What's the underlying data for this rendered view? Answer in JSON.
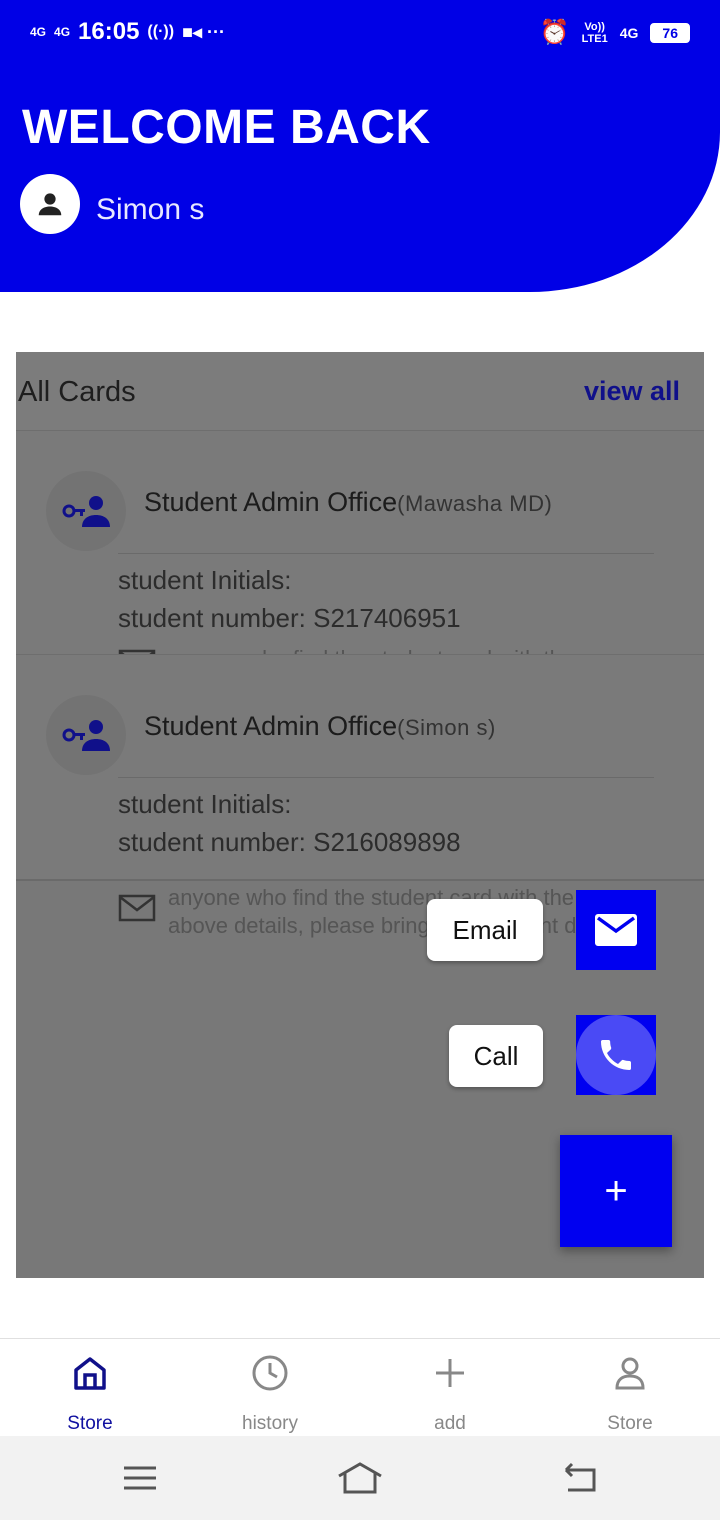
{
  "status_bar": {
    "signal1": "4G",
    "signal2": "4G",
    "time": "16:05",
    "volte": "Vo))",
    "lte": "LTE1",
    "net": "4G",
    "battery": "76"
  },
  "header": {
    "title": "WELCOME BACK",
    "username": "Simon s"
  },
  "cards_section": {
    "title": "All Cards",
    "view_all": "view all"
  },
  "cards": [
    {
      "title": "Student Admin Office",
      "owner": "(Mawasha MD)",
      "initials": "student Initials:",
      "number": "student number: S217406951",
      "message": "anyone who find the student card with the"
    },
    {
      "title": "Student Admin Office",
      "owner": "(Simon s)",
      "initials": "student Initials:",
      "number": "student number: S216089898",
      "message": "anyone who find the student card with the"
    }
  ],
  "overflow_message": "above details, please bring it to the front desk",
  "fab": {
    "email_label": "Email",
    "call_label": "Call",
    "main_symbol": "+"
  },
  "bottom_nav": {
    "items": [
      {
        "label": "Store",
        "icon": "home-icon",
        "active": true
      },
      {
        "label": "history",
        "icon": "clock-icon",
        "active": false
      },
      {
        "label": "add",
        "icon": "plus-icon",
        "active": false
      },
      {
        "label": "Store",
        "icon": "person-icon",
        "active": false
      }
    ]
  },
  "colors": {
    "primary": "#0000e6",
    "overlay": "#787878",
    "nav_active": "#1010a0"
  }
}
